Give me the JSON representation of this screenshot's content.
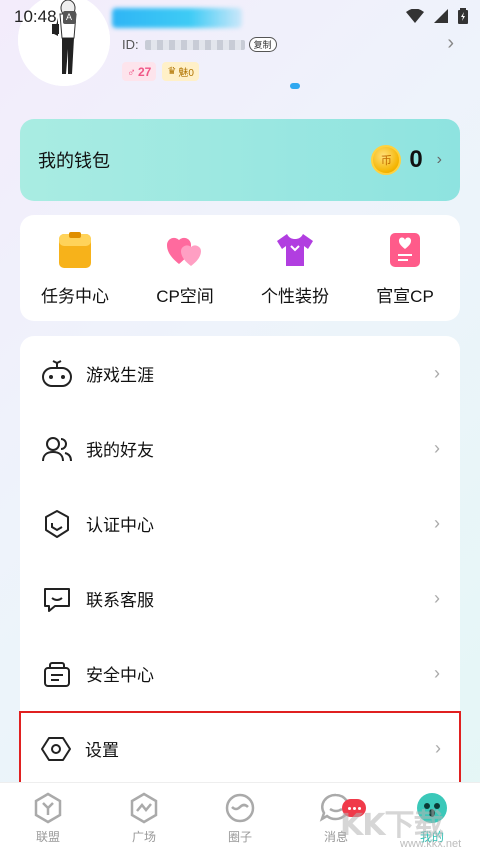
{
  "status_bar": {
    "time": "10:48",
    "a_badge": "A"
  },
  "profile": {
    "id_label": "ID:",
    "copy_label": "复制",
    "likes": "27",
    "charm": "魅0"
  },
  "wallet": {
    "title": "我的钱包",
    "coin_glyph": "币",
    "value": "0"
  },
  "quick_actions": [
    {
      "label": "任务中心",
      "icon": "task-icon"
    },
    {
      "label": "CP空间",
      "icon": "hearts-icon"
    },
    {
      "label": "个性装扮",
      "icon": "tshirt-icon"
    },
    {
      "label": "官宣CP",
      "icon": "announce-icon"
    }
  ],
  "menu": [
    {
      "label": "游戏生涯",
      "icon": "gamepad-icon"
    },
    {
      "label": "我的好友",
      "icon": "friends-icon"
    },
    {
      "label": "认证中心",
      "icon": "shield-icon"
    },
    {
      "label": "联系客服",
      "icon": "chat-icon"
    },
    {
      "label": "安全中心",
      "icon": "lock-icon"
    },
    {
      "label": "设置",
      "icon": "settings-icon"
    }
  ],
  "tabs": [
    {
      "label": "联盟",
      "icon": "alliance-icon",
      "active": false
    },
    {
      "label": "广场",
      "icon": "plaza-icon",
      "active": false
    },
    {
      "label": "圈子",
      "icon": "circle-icon",
      "active": false
    },
    {
      "label": "消息",
      "icon": "message-icon",
      "active": false
    },
    {
      "label": "我的",
      "icon": "me-icon",
      "active": true
    }
  ],
  "watermark": {
    "text": "KK下载",
    "sub": "www.kkx.net"
  },
  "colors": {
    "accent": "#2cc2b5",
    "wallet": "#99e6e1",
    "highlight": "#e02020"
  }
}
